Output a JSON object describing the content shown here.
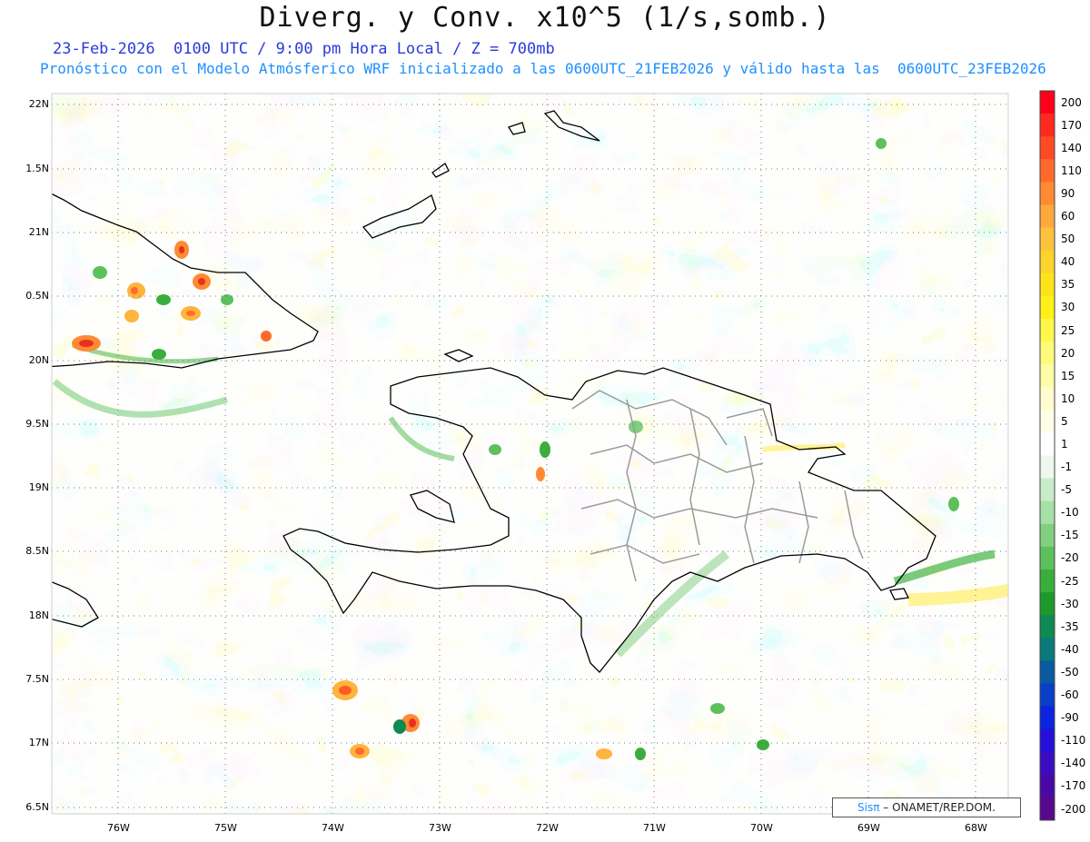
{
  "title": "Diverg. y Conv. x10^5 (1/s,somb.)",
  "subtitle_line1": "23-Feb-2026  0100 UTC / 9:00 pm Hora Local / Z = 700mb",
  "subtitle_line2": "Pronóstico con el Modelo Atmósferico WRF inicializado a las 0600UTC_21FEB2026 y válido hasta las  0600UTC_23FEB2026",
  "credit": {
    "brand": "Sisπ",
    "text": "– ONAMET/REP.DOM."
  },
  "lat_labels": [
    "22N",
    "1.5N",
    "21N",
    "0.5N",
    "20N",
    "9.5N",
    "19N",
    "8.5N",
    "18N",
    "7.5N",
    "17N",
    "6.5N"
  ],
  "lon_labels": [
    "76W",
    "75W",
    "74W",
    "73W",
    "72W",
    "71W",
    "70W",
    "69W",
    "68W"
  ],
  "colorbar": {
    "labels": [
      "200",
      "170",
      "140",
      "110",
      "90",
      "60",
      "50",
      "40",
      "35",
      "30",
      "25",
      "20",
      "15",
      "10",
      "5",
      "1",
      "-1",
      "-5",
      "-10",
      "-15",
      "-20",
      "-25",
      "-30",
      "-35",
      "-40",
      "-50",
      "-60",
      "-90",
      "-110",
      "-140",
      "-170",
      "-200"
    ],
    "colors": [
      "#ff0018",
      "#ff2a1f",
      "#ff4a24",
      "#ff6a2c",
      "#ff8a34",
      "#ffa93c",
      "#ffc23c",
      "#ffd42a",
      "#ffe31a",
      "#fff01a",
      "#fff74a",
      "#fffb7a",
      "#fffca8",
      "#fffdd0",
      "#fffee8",
      "#ffffff",
      "#eef8ee",
      "#c8ecc8",
      "#a6e0a6",
      "#80d080",
      "#5cc05c",
      "#3aae3a",
      "#1c9a2c",
      "#0f8a52",
      "#0b7a7a",
      "#0a5aa0",
      "#0a3ec8",
      "#0a24e0",
      "#2410d8",
      "#3a0cc0",
      "#4a08a6",
      "#58088c"
    ]
  },
  "colors": {
    "title": "#111111",
    "subtitle1": "#2a3ad8",
    "subtitle2": "#1e90ff",
    "coast": "#000000",
    "provinces": "#9a9a9a",
    "grid": "#777777"
  }
}
